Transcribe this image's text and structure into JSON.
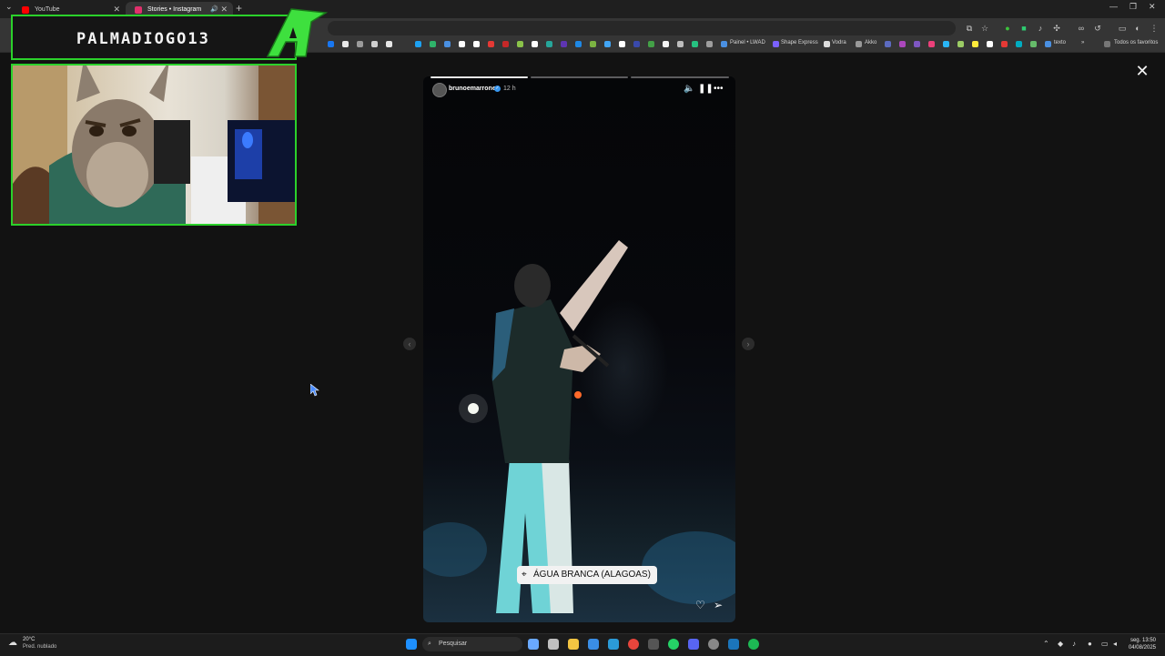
{
  "browser": {
    "tabs": [
      {
        "label": "YouTube",
        "favicon_color": "#ff0000",
        "active": false
      },
      {
        "label": "Stories • Instagram",
        "favicon_color": "#e1306c",
        "active": true
      }
    ],
    "bookmarks": [
      {
        "label": "Painel • LWAD",
        "color": "#4a90e2"
      },
      {
        "label": "Shape Express",
        "color": "#7b61ff"
      },
      {
        "label": "Vodra",
        "color": "#dddddd"
      },
      {
        "label": "Akko",
        "color": "#999999"
      },
      {
        "label": "texto",
        "color": "#4a90e2"
      }
    ],
    "all_bookmarks_label": "Todos os favoritos"
  },
  "stream_overlay": {
    "channel_name": "PALMADIOGO13",
    "accent_color": "#2bd12b"
  },
  "story": {
    "username": "brunoemarrone",
    "time_ago": "12 h",
    "location_sticker": "ÁGUA BRANCA (ALAGOAS)",
    "progress_segments": 3,
    "progress_done": 1
  },
  "viewer": {
    "close_icon": "close-icon",
    "prev_icon": "chevron-left-icon",
    "next_icon": "chevron-right-icon"
  },
  "taskbar": {
    "weather_temp": "20°C",
    "weather_desc": "Pred. nublado",
    "search_placeholder": "Pesquisar",
    "clock_day": "seg. 13:50",
    "clock_date": "04/08/2025"
  }
}
